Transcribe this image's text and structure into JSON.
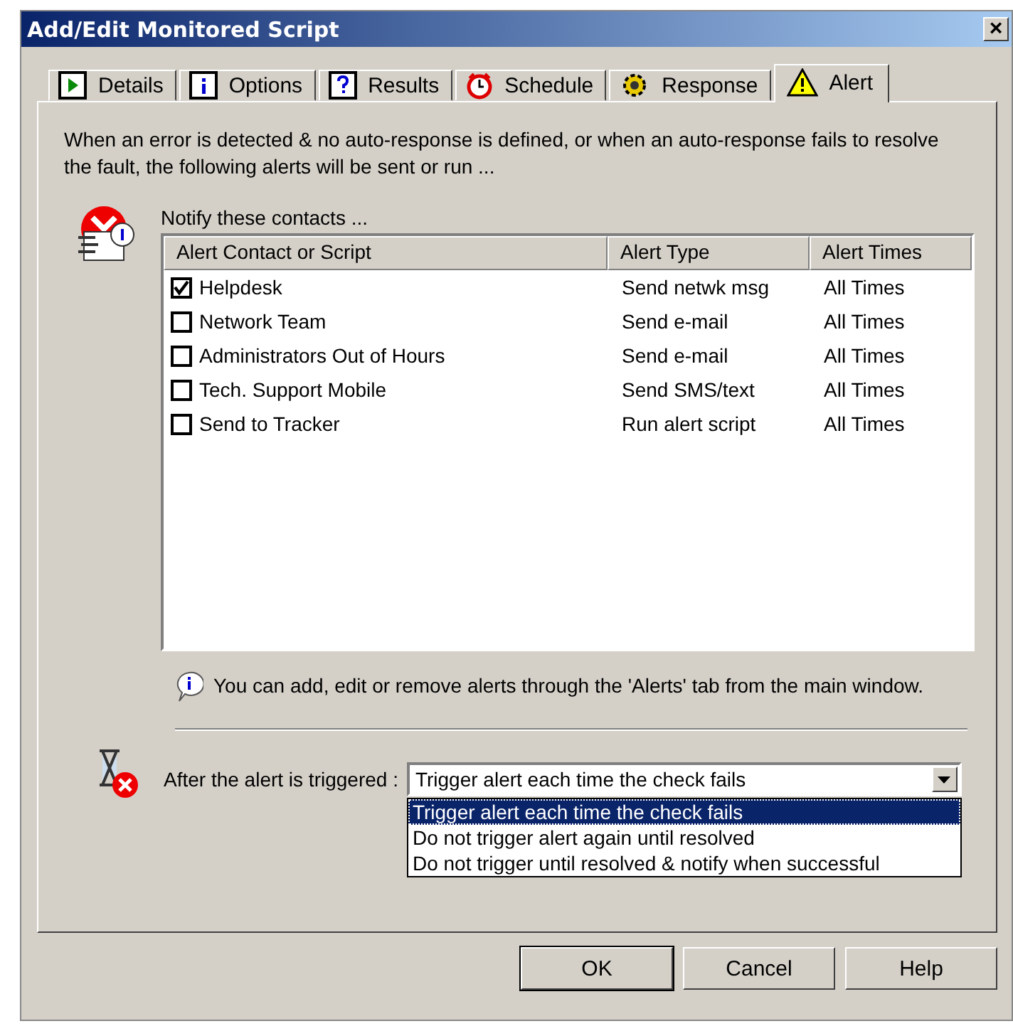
{
  "window": {
    "title": "Add/Edit Monitored Script",
    "close": "×"
  },
  "tabs": [
    {
      "label": "Details",
      "kind": "play",
      "selected": false
    },
    {
      "label": "Options",
      "kind": "info",
      "selected": false
    },
    {
      "label": "Results",
      "kind": "question",
      "selected": false
    },
    {
      "label": "Schedule",
      "kind": "clock",
      "selected": false
    },
    {
      "label": "Response",
      "kind": "gear",
      "selected": false
    },
    {
      "label": "Alert",
      "kind": "warning",
      "selected": true
    }
  ],
  "intro": "When an error is detected & no auto-response is defined, or when an auto-response fails to resolve the fault, the following alerts will be sent or run ...",
  "contacts": {
    "label": "Notify these contacts ...",
    "columns": [
      "Alert Contact or Script",
      "Alert Type",
      "Alert Times"
    ],
    "rows": [
      {
        "name": "Helpdesk",
        "type": "Send netwk msg",
        "times": "All Times",
        "checked": true
      },
      {
        "name": "Network Team",
        "type": "Send e-mail",
        "times": "All Times",
        "checked": false
      },
      {
        "name": "Administrators Out of Hours",
        "type": "Send e-mail",
        "times": "All Times",
        "checked": false
      },
      {
        "name": "Tech. Support Mobile",
        "type": "Send SMS/text",
        "times": "All Times",
        "checked": false
      },
      {
        "name": "Send to Tracker",
        "type": "Run alert script",
        "times": "All Times",
        "checked": false
      }
    ]
  },
  "hint": "You can add, edit or remove alerts through the 'Alerts' tab from the main window.",
  "trigger": {
    "label": "After the alert is triggered :",
    "value": "Trigger alert each time the check fails",
    "options": [
      {
        "label": "Trigger alert each time the check fails",
        "selected": true
      },
      {
        "label": "Do not trigger alert again until resolved",
        "selected": false
      },
      {
        "label": "Do not trigger until resolved & notify when successful",
        "selected": false
      }
    ]
  },
  "buttons": [
    {
      "label": "OK",
      "kind": "default"
    },
    {
      "label": "Cancel",
      "kind": "normal"
    },
    {
      "label": "Help",
      "kind": "normal"
    }
  ]
}
